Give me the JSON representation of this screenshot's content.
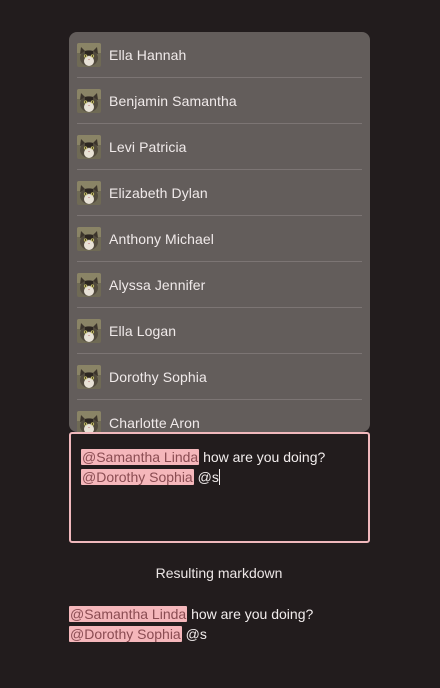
{
  "suggestions": [
    {
      "name": "Ella Hannah",
      "icon": "cat-avatar-icon"
    },
    {
      "name": "Benjamin Samantha",
      "icon": "cat-avatar-icon"
    },
    {
      "name": "Levi Patricia",
      "icon": "cat-avatar-icon"
    },
    {
      "name": "Elizabeth Dylan",
      "icon": "cat-avatar-icon"
    },
    {
      "name": "Anthony Michael",
      "icon": "cat-avatar-icon"
    },
    {
      "name": "Alyssa Jennifer",
      "icon": "cat-avatar-icon"
    },
    {
      "name": "Ella Logan",
      "icon": "cat-avatar-icon"
    },
    {
      "name": "Dorothy Sophia",
      "icon": "cat-avatar-icon"
    },
    {
      "name": "Charlotte Aron",
      "icon": "cat-avatar-icon"
    }
  ],
  "editor": {
    "line1": {
      "mention": "@Samantha Linda",
      "text": " how are you doing?"
    },
    "line2": {
      "mention": "@Dorothy Sophia",
      "text": " @s"
    }
  },
  "result": {
    "title": "Resulting markdown",
    "line1": {
      "mention": "@Samantha Linda",
      "text": " how are you doing?"
    },
    "line2": {
      "mention": "@Dorothy Sophia",
      "text": " @s"
    }
  },
  "colors": {
    "background": "#221c1d",
    "panel": "#635d5b",
    "mention_bg": "#f5b7bb",
    "focus_border": "#f0b8bc"
  }
}
